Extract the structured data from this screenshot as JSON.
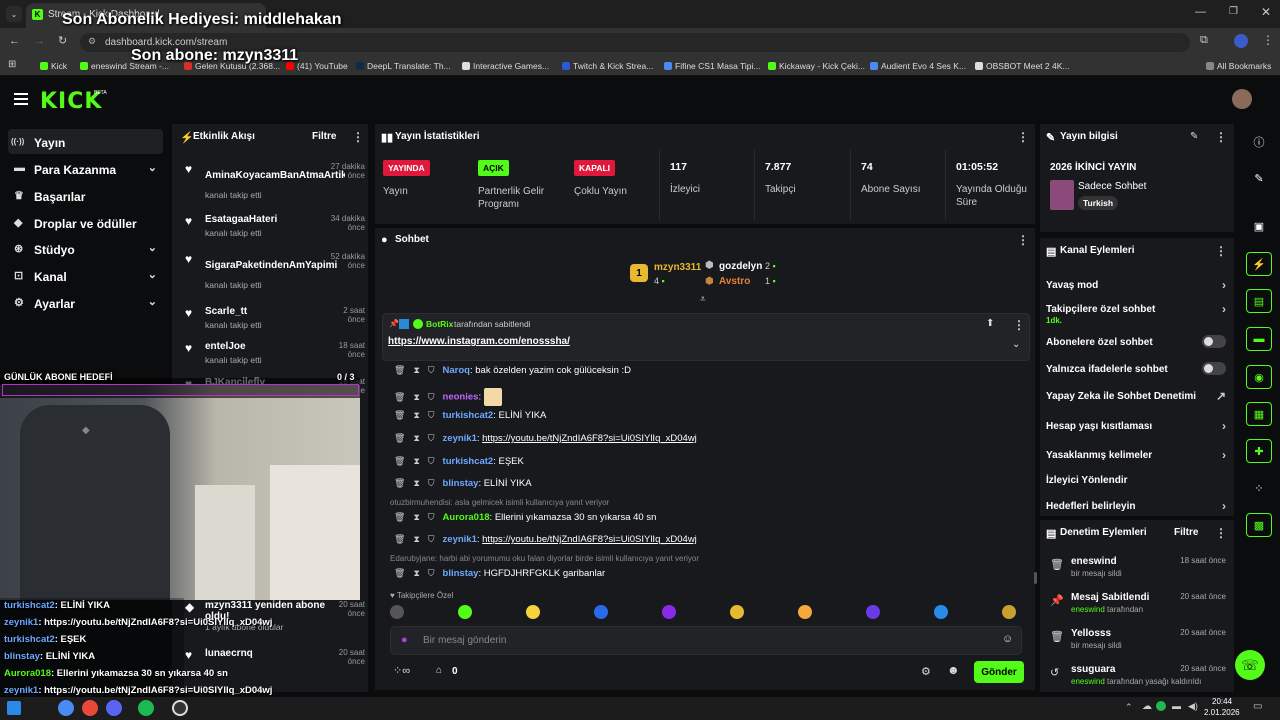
{
  "browser": {
    "tab_title": "Stream - Kick Dashboard",
    "url": "dashboard.kick.com/stream",
    "bookmarks": [
      "Kick",
      "eneswind Stream -...",
      "Gelen Kutusu (2.368...",
      "(41) YouTube",
      "DeepL Translate: Th...",
      "Interactive Games...",
      "Twitch & Kick Strea...",
      "Fifine CS1 Masa Tipi...",
      "Kickaway - Kick Çeki...",
      "Audient Evo 4 Ses K...",
      "OBSBOT Meet 2 4K..."
    ],
    "all_bookmarks": "All Bookmarks"
  },
  "overlay": {
    "gift_text": "Son Abonelik Hediyesi: middlehakan",
    "last_sub_text": "Son abone: mzyn3311",
    "daily_goal_label": "GÜNLÜK ABONE HEDEFİ",
    "daily_goal_count": "0 / 3"
  },
  "header": {
    "logo": "KICK",
    "beta": "BETA"
  },
  "nav": [
    {
      "label": "Yayın",
      "icon": "broadcast-icon",
      "active": true,
      "chev": false
    },
    {
      "label": "Para Kazanma",
      "icon": "money-icon",
      "chev": true
    },
    {
      "label": "Başarılar",
      "icon": "trophy-icon",
      "chev": false
    },
    {
      "label": "Droplar ve ödüller",
      "icon": "gift-icon",
      "chev": false
    },
    {
      "label": "Stüdyo",
      "icon": "studio-icon",
      "chev": true
    },
    {
      "label": "Kanal",
      "icon": "channel-icon",
      "chev": true
    },
    {
      "label": "Ayarlar",
      "icon": "gear-icon",
      "chev": true
    }
  ],
  "activity": {
    "title": "Etkinlik Akışı",
    "filter": "Filtre",
    "items": [
      {
        "name": "AminaKoyacamBanAtmaArtik",
        "sub": "kanalı takip etti",
        "time": "27 dakika önce"
      },
      {
        "name": "EsatagaaHateri",
        "sub": "kanalı takip etti",
        "time": "34 dakika önce"
      },
      {
        "name": "SigaraPaketindenAmYapimi",
        "sub": "kanalı takip etti",
        "time": "52 dakika önce"
      },
      {
        "name": "Scarle_tt",
        "sub": "kanalı takip etti",
        "time": "2 saat önce"
      },
      {
        "name": "entelJoe",
        "sub": "kanalı takip etti",
        "time": "18 saat önce"
      },
      {
        "name": "BJKancilefly",
        "sub": "kanalı takip etti",
        "time": "18 saat önce"
      }
    ],
    "bottom_items": [
      {
        "name": "mzyn3311 yeniden abone oldu!",
        "sub": "1 aylık abone oldular",
        "time": "20 saat önce"
      },
      {
        "name": "lunaecrnq",
        "sub": "",
        "time": "20 saat önce"
      }
    ]
  },
  "stats": {
    "title": "Yayın İstatistikleri",
    "items": [
      {
        "badge": "YAYINDA",
        "badge_color": "#e0183c",
        "label": "Yayın"
      },
      {
        "badge": "AÇIK",
        "badge_color": "#53fc18",
        "label": "Partnerlik Gelir Programı"
      },
      {
        "badge": "KAPALI",
        "badge_color": "#e0183c",
        "label": "Çoklu Yayın"
      },
      {
        "value": "117",
        "label": "İzleyici"
      },
      {
        "value": "7.877",
        "label": "Takipçi"
      },
      {
        "value": "74",
        "label": "Abone Sayısı"
      },
      {
        "value": "01:05:52",
        "label": "Yayında Olduğu Süre"
      }
    ]
  },
  "chat": {
    "title": "Sohbet",
    "top_gifters": [
      {
        "name": "mzyn3311",
        "count": "4",
        "rank": "1"
      },
      {
        "name": "gozdelyn",
        "count": "2"
      },
      {
        "name": "Avstro",
        "count": "1"
      }
    ],
    "pinned_by": "BotRix",
    "pinned_suffix": "tarafından sabitlendi",
    "pinned_link": "https://www.instagram.com/enosssha/",
    "messages": [
      {
        "user": "Naroq",
        "color": "#6fa8ff",
        "text": "bak özelden yazim cok gülüceksin :D",
        "link": false
      },
      {
        "user": "neonies",
        "color": "#c066ff",
        "text": "",
        "link": false
      },
      {
        "user": "turkishcat2",
        "color": "#6fa8ff",
        "text": "ELİNİ YIKA",
        "link": false
      },
      {
        "user": "zeynik1",
        "color": "#6fa8ff",
        "text": "https://youtu.be/tNjZndIA6F8?si=Ui0SIYlIq_xD04wj",
        "link": true
      },
      {
        "user": "turkishcat2",
        "color": "#6fa8ff",
        "text": "EŞEK",
        "link": false
      },
      {
        "user": "blinstay",
        "color": "#6fa8ff",
        "text": "ELİNİ YIKA",
        "link": false
      },
      {
        "user": "Aurora018",
        "color": "#53fc18",
        "text": "Ellerini yıkamazsa 30 sn yıkarsa 40 sn",
        "link": false
      },
      {
        "user": "zeynik1",
        "color": "#6fa8ff",
        "text": "https://youtu.be/tNjZndIA6F8?si=Ui0SIYlIq_xD04wj",
        "link": true
      },
      {
        "user": "blinstay",
        "color": "#6fa8ff",
        "text": "HGFDJHRFGKLK garibanlar",
        "link": false
      }
    ],
    "sys1": "otuzbirmuhendisi: asla gelmicek isimli kullanıcıya yanıt veriyor",
    "sys2": "Edarubyjane: harbi abi yorumumu oku falan diyorlar birde isimli kullanıcıya yanıt veriyor",
    "follower_only": "Takipçilere Özel",
    "input_placeholder": "Bir mesaj gönderin",
    "send": "Gönder",
    "points": "0"
  },
  "stream_info": {
    "title": "Yayın bilgisi",
    "stream_title": "2026 İKİNCİ YAYIN",
    "category": "Sadece Sohbet",
    "tag": "Turkish"
  },
  "channel_actions": {
    "title": "Kanal Eylemleri",
    "items": [
      {
        "label": "Yavaş mod",
        "type": "chev"
      },
      {
        "label": "Takipçilere özel sohbet",
        "sub": "1dk.",
        "type": "chev"
      },
      {
        "label": "Abonelere özel sohbet",
        "type": "toggle"
      },
      {
        "label": "Yalnızca ifadelerle sohbet",
        "type": "toggle"
      },
      {
        "label": "Yapay Zeka ile Sohbet Denetimi",
        "type": "ext"
      },
      {
        "label": "Hesap yaşı kısıtlaması",
        "type": "chev"
      },
      {
        "label": "Yasaklanmış kelimeler",
        "type": "chev"
      },
      {
        "label": "İzleyici Yönlendir",
        "type": "none"
      },
      {
        "label": "Hedefleri belirleyin",
        "type": "chev"
      }
    ]
  },
  "mod_actions": {
    "title": "Denetim Eylemleri",
    "filter": "Filtre",
    "items": [
      {
        "name": "eneswind",
        "sub": "bir mesajı sildi",
        "time": "18 saat önce",
        "icon": "trash-icon"
      },
      {
        "name": "Mesaj Sabitlendi",
        "sub": "eneswind tarafından",
        "time": "20 saat önce",
        "icon": "pin-icon"
      },
      {
        "name": "Yellosss",
        "sub": "bir mesajı sildi",
        "time": "20 saat önce",
        "icon": "trash-icon"
      },
      {
        "name": "ssuguara",
        "sub": "eneswind tarafından yasağı kaldırıldı",
        "time": "20 saat önce",
        "icon": "undo-icon"
      }
    ]
  },
  "overlay_chat": [
    {
      "user": "turkishcat2",
      "color": "#6fa8ff",
      "text": ": ELİNİ YIKA"
    },
    {
      "user": "zeynik1",
      "color": "#6fa8ff",
      "text": ": https://youtu.be/tNjZndIA6F8?si=Ui0SIYlIq_xD04wj"
    },
    {
      "user": "turkishcat2",
      "color": "#6fa8ff",
      "text": ": EŞEK"
    },
    {
      "user": "blinstay",
      "color": "#6fa8ff",
      "text": ":  ELİNİ YIKA"
    },
    {
      "user": "Aurora018",
      "color": "#53fc18",
      "text": ": Ellerini yıkamazsa 30 sn yıkarsa 40 sn"
    },
    {
      "user": "zeynik1",
      "color": "#6fa8ff",
      "text": ": https://youtu.be/tNjZndIA6F8?si=Ui0SIYlIq_xD04wj"
    },
    {
      "user": "blinstay",
      "color": "#6fa8ff",
      "text": ": HGFDJHRFGKLK garibanlar"
    }
  ],
  "taskbar": {
    "time": "20:44",
    "date": "2.01.2026"
  },
  "colors": {
    "accent": "#53fc18",
    "live": "#e0183c",
    "panel": "#18191c",
    "bg": "#0b0c0e"
  }
}
